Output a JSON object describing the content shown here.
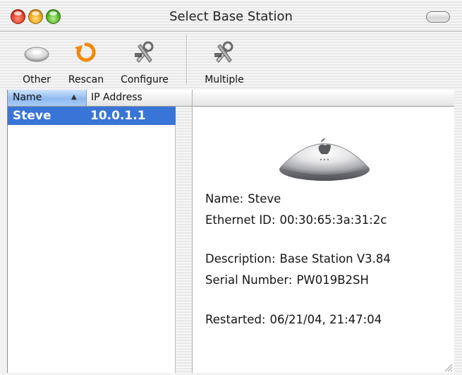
{
  "window": {
    "title": "Select Base Station"
  },
  "toolbar": {
    "other_label": "Other",
    "rescan_label": "Rescan",
    "configure_label": "Configure",
    "multiple_label": "Multiple"
  },
  "list": {
    "columns": {
      "name": "Name",
      "ip": "IP Address"
    },
    "sort_indicator": "▲",
    "rows": [
      {
        "name": "Steve",
        "ip": "10.0.1.1"
      }
    ]
  },
  "details": {
    "name_label": "Name:",
    "name_value": "Steve",
    "ethernet_label": "Ethernet ID:",
    "ethernet_value": "00:30:65:3a:31:2c",
    "description_label": "Description:",
    "description_value": "Base Station V3.84",
    "serial_label": "Serial Number:",
    "serial_value": "PW019B2SH",
    "restarted_label": "Restarted:",
    "restarted_value": "06/21/04, 21:47:04"
  },
  "colors": {
    "selection": "#3875d7",
    "close": "#e0412b",
    "minimize": "#eaa018",
    "zoom": "#54b42a",
    "rescan_accent": "#f08a0c"
  },
  "icons": {
    "other": "base-station-small-icon",
    "rescan": "refresh-arrow-icon",
    "configure": "tools-icon",
    "multiple": "tools-icon",
    "detail": "base-station-icon"
  }
}
